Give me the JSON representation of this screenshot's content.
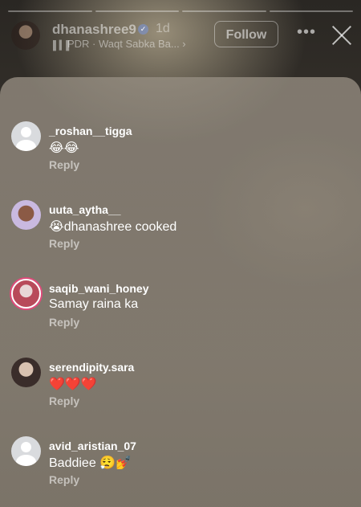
{
  "story": {
    "username": "dhanashree9",
    "time": "1d",
    "music": "PDR · Waqt Sabka Ba... ›",
    "follow_label": "Follow",
    "more_label": "•••"
  },
  "comments": [
    {
      "user": "_roshan__tigga",
      "text": "😂😂",
      "reply": "Reply",
      "avatar": "default-avatar"
    },
    {
      "user": "uuta_aytha__",
      "text": "😭dhanashree cooked",
      "reply": "Reply",
      "avatar": "photo-avatar"
    },
    {
      "user": "saqib_wani_honey",
      "text": "Samay raina ka",
      "reply": "Reply",
      "avatar": "story-ring-avatar"
    },
    {
      "user": "serendipity.sara",
      "text": "❤️❤️❤️",
      "reply": "Reply",
      "avatar": "photo-avatar"
    },
    {
      "user": "avid_aristian_07",
      "text": "Baddiee 😮‍💨💅",
      "reply": "Reply",
      "avatar": "default-avatar"
    }
  ]
}
